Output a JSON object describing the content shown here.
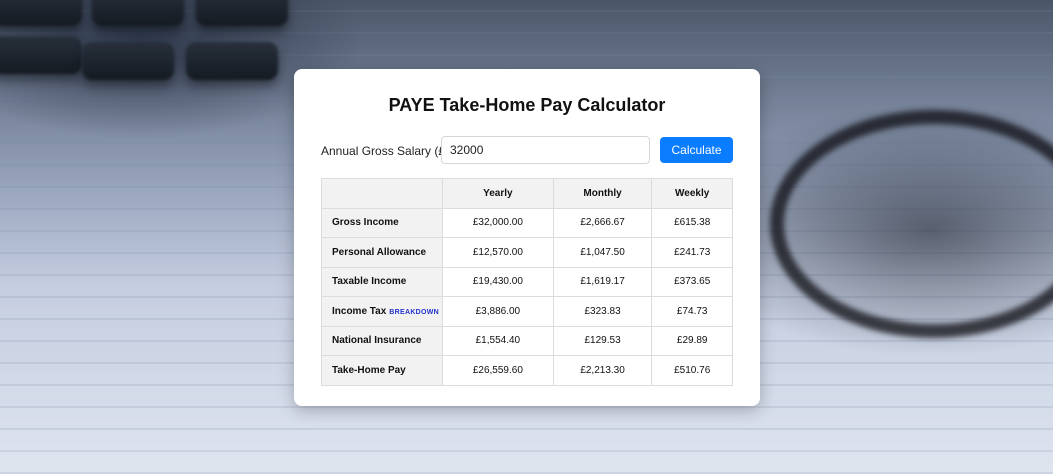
{
  "app": {
    "title": "PAYE Take-Home Pay Calculator"
  },
  "form": {
    "salary_label": "Annual Gross Salary (£):",
    "salary_value": "32000",
    "calculate_label": "Calculate"
  },
  "table": {
    "corner": "",
    "columns": [
      "Yearly",
      "Monthly",
      "Weekly"
    ],
    "breakdown_label": "BREAKDOWN",
    "rows": [
      {
        "label": "Gross Income",
        "values": [
          "£32,000.00",
          "£2,666.67",
          "£615.38"
        ]
      },
      {
        "label": "Personal Allowance",
        "values": [
          "£12,570.00",
          "£1,047.50",
          "£241.73"
        ]
      },
      {
        "label": "Taxable Income",
        "values": [
          "£19,430.00",
          "£1,619.17",
          "£373.65"
        ]
      },
      {
        "label": "Income Tax",
        "values": [
          "£3,886.00",
          "£323.83",
          "£74.73"
        ]
      },
      {
        "label": "National Insurance",
        "values": [
          "£1,554.40",
          "£129.53",
          "£29.89"
        ]
      },
      {
        "label": "Take-Home Pay",
        "values": [
          "£26,559.60",
          "£2,213.30",
          "£510.76"
        ]
      }
    ]
  },
  "colors": {
    "accent": "#0a7cff",
    "link": "#2233cc"
  }
}
